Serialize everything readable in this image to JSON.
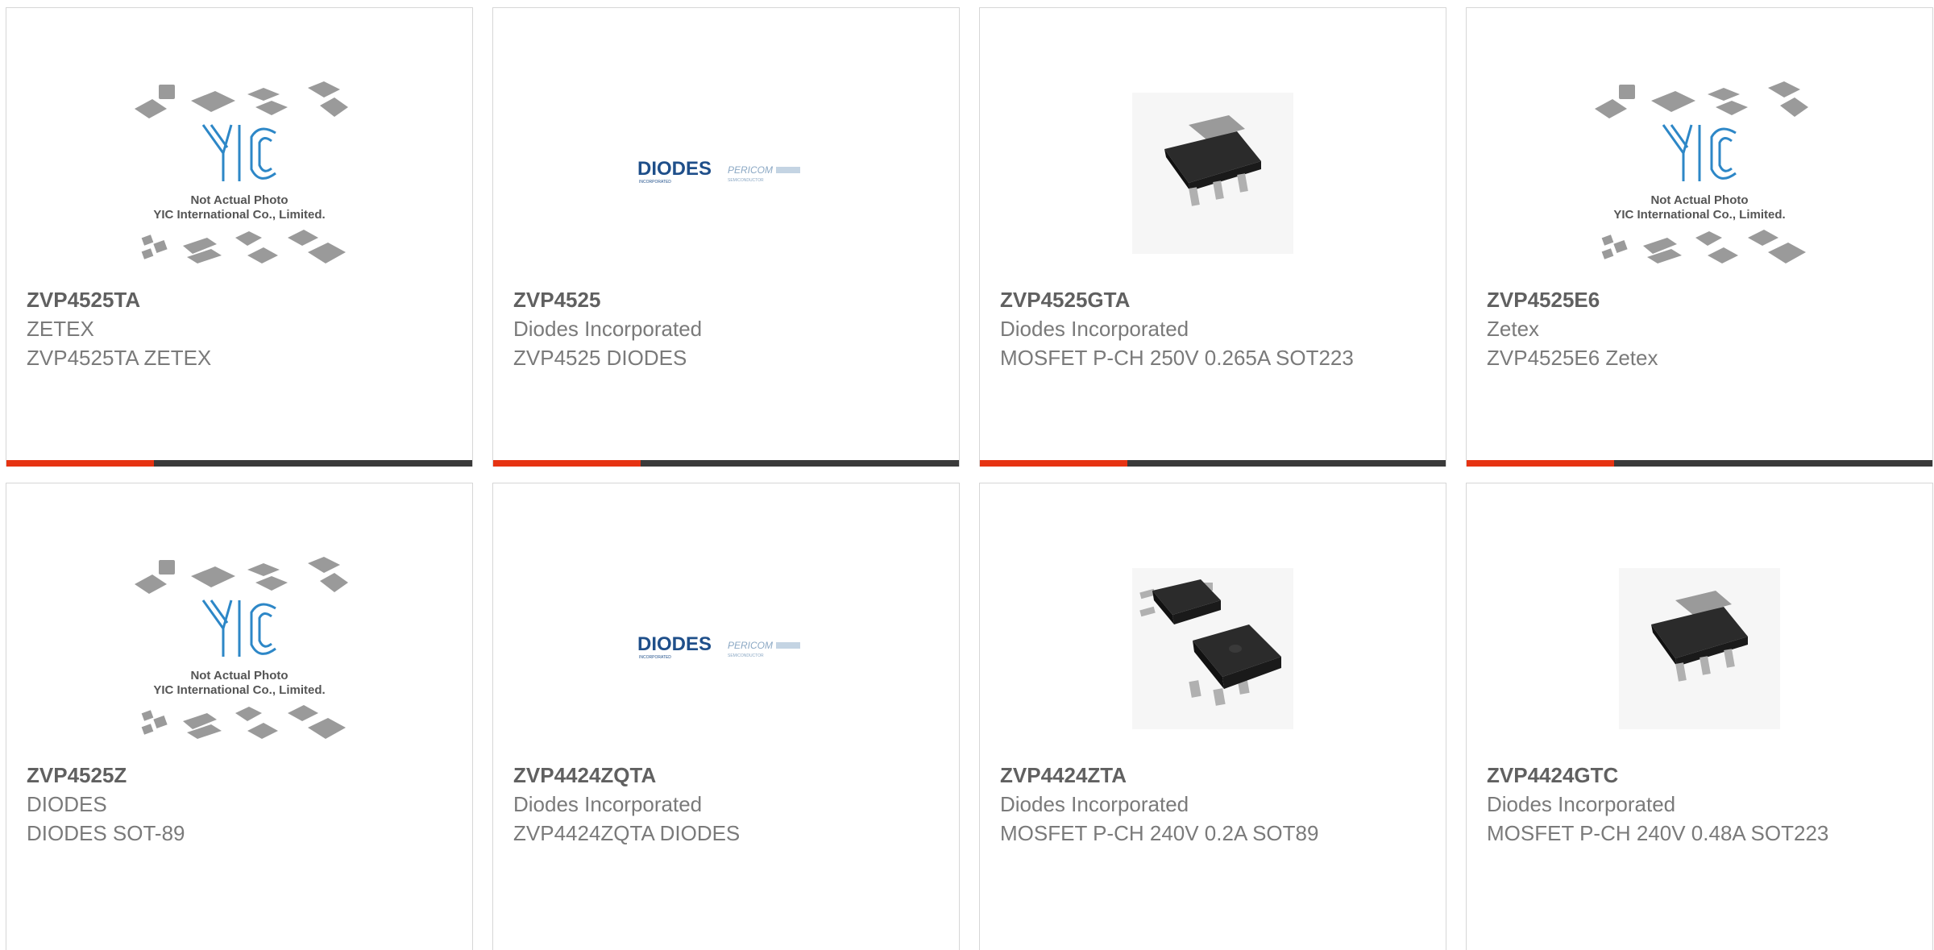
{
  "products": [
    {
      "part": "ZVP4525TA",
      "manufacturer": "ZETEX",
      "description": "ZVP4525TA ZETEX",
      "image": "yic-placeholder-icon"
    },
    {
      "part": "ZVP4525",
      "manufacturer": "Diodes Incorporated",
      "description": "ZVP4525 DIODES",
      "image": "diodes-logo"
    },
    {
      "part": "ZVP4525GTA",
      "manufacturer": "Diodes Incorporated",
      "description": "MOSFET P-CH 250V 0.265A SOT223",
      "image": "sot223-package-icon"
    },
    {
      "part": "ZVP4525E6",
      "manufacturer": "Zetex",
      "description": "ZVP4525E6 Zetex",
      "image": "yic-placeholder-icon"
    },
    {
      "part": "ZVP4525Z",
      "manufacturer": "DIODES",
      "description": "DIODES SOT-89",
      "image": "yic-placeholder-icon"
    },
    {
      "part": "ZVP4424ZQTA",
      "manufacturer": "Diodes Incorporated",
      "description": "ZVP4424ZQTA DIODES",
      "image": "diodes-logo"
    },
    {
      "part": "ZVP4424ZTA",
      "manufacturer": "Diodes Incorporated",
      "description": "MOSFET P-CH 240V 0.2A SOT89",
      "image": "sot89-package-icon"
    },
    {
      "part": "ZVP4424GTC",
      "manufacturer": "Diodes Incorporated",
      "description": "MOSFET P-CH 240V 0.48A SOT223",
      "image": "sot223-package-icon"
    }
  ],
  "placeholder": {
    "brand": "YIC",
    "line1": "Not Actual Photo",
    "line2": "YIC International Co., Limited."
  },
  "logos": {
    "diodes": "DIODES",
    "diodes_sub": "INCORPORATED",
    "pericom": "PERICOM",
    "pericom_sub": "SEMICONDUCTOR"
  },
  "colors": {
    "accent": "#e63312",
    "bar": "#3a3a3a",
    "text": "#7a7a7a",
    "part": "#606060",
    "brand_blue": "#1e7fc0"
  }
}
